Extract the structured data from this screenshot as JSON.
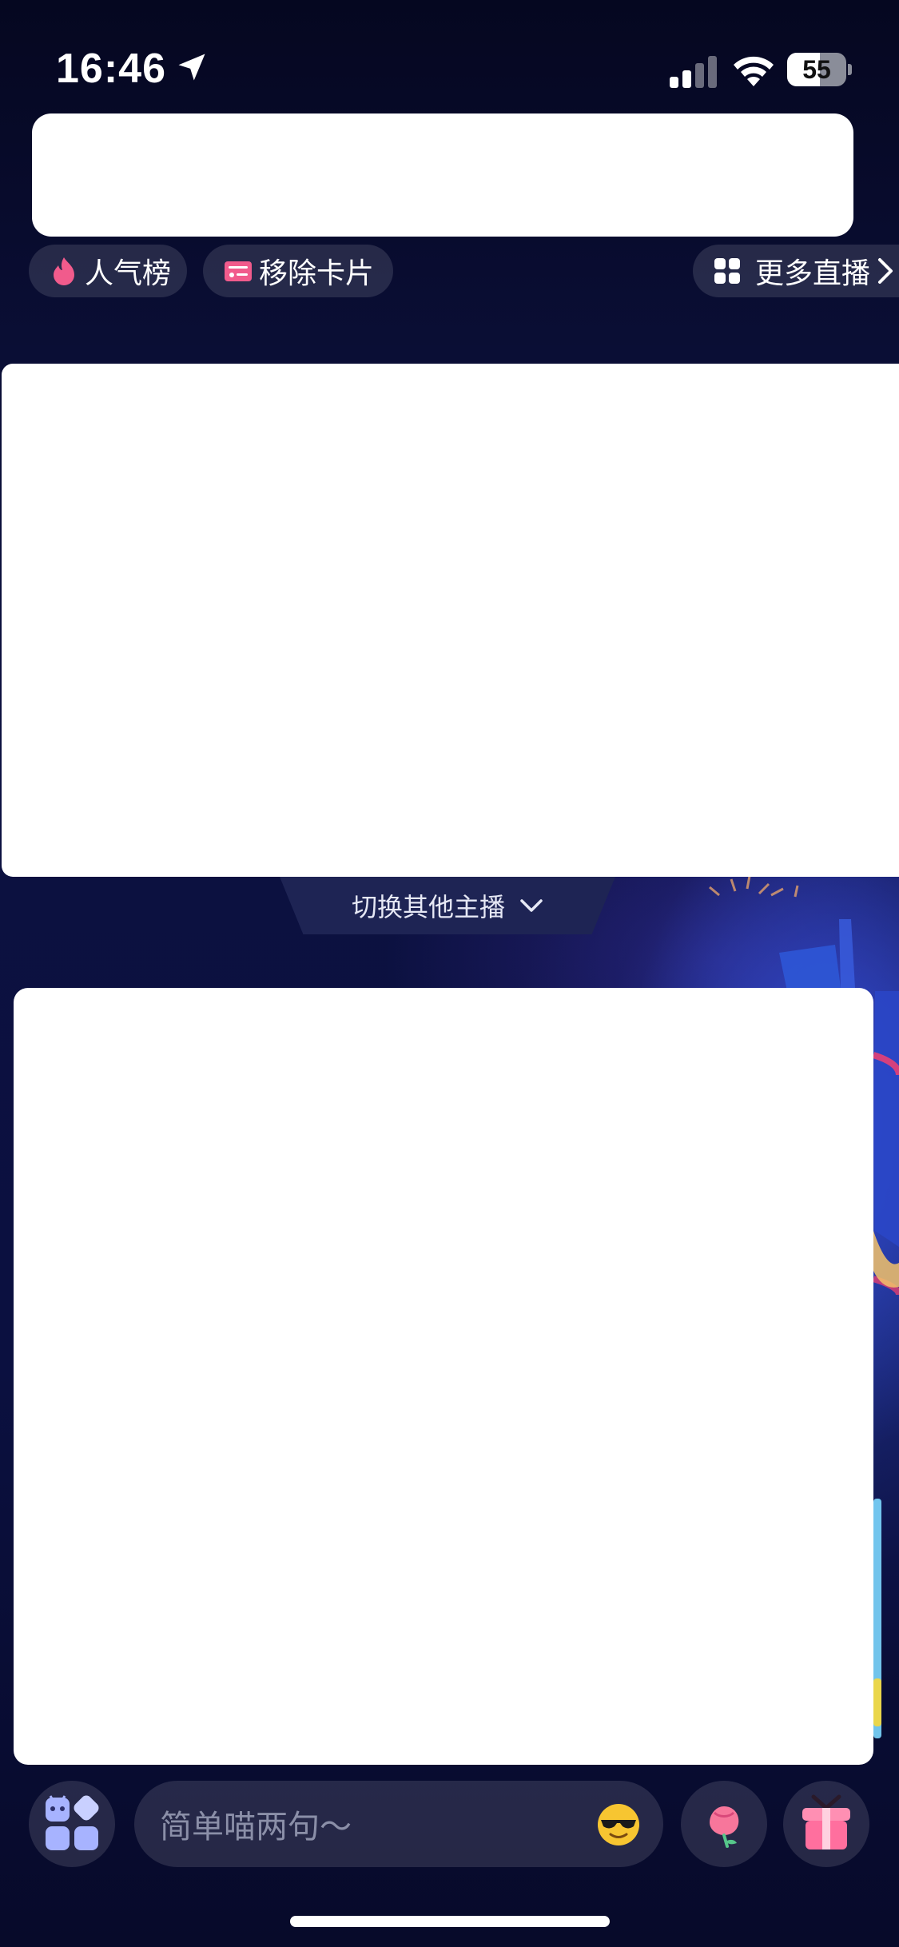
{
  "status_bar": {
    "time": "16:46",
    "battery_level": "55",
    "battery_fraction": 0.55,
    "icons": [
      "location-arrow-icon",
      "cellular-signal-icon",
      "wifi-icon",
      "battery-icon"
    ]
  },
  "top_actions": {
    "popularity_rank_label": "人气榜",
    "remove_card_label": "移除卡片",
    "more_live_label": "更多直播"
  },
  "switch_anchor": {
    "label": "切换其他主播"
  },
  "bottom_bar": {
    "input_placeholder": "简单喵两句～",
    "icons": [
      "apps-grid-icon",
      "sunglasses-emoji-icon",
      "flower-gift-icon",
      "gift-box-icon"
    ]
  },
  "colors": {
    "background": "#0a0e35",
    "chip_bg": "rgba(255,255,255,0.12)",
    "accent_pink": "#f15b8c",
    "switch_tab_bg": "#1e2454"
  }
}
